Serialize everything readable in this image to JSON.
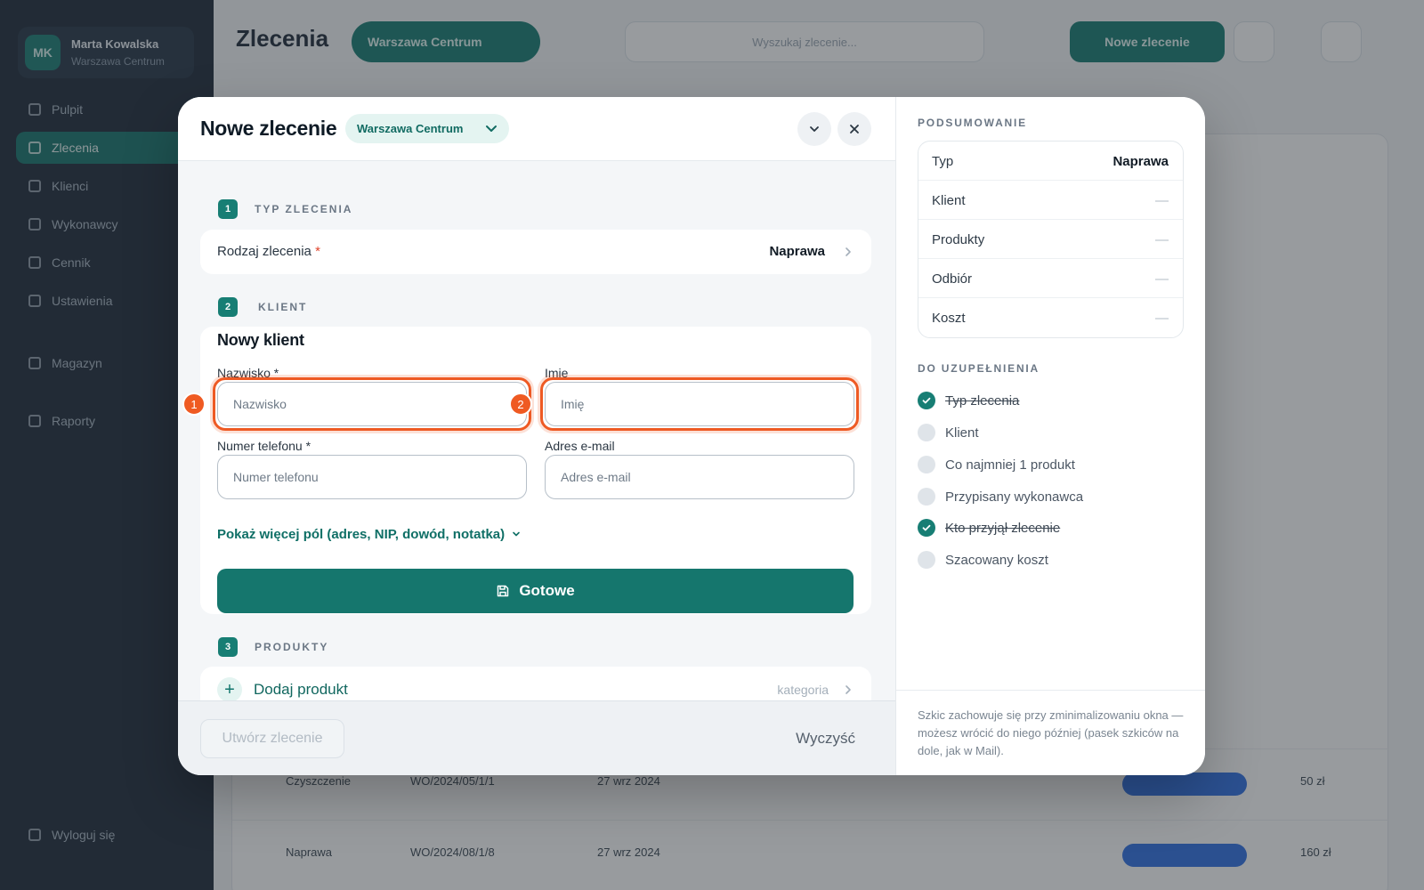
{
  "background": {
    "sidebar": {
      "user_initials": "MK",
      "user_name": "Marta Kowalska",
      "user_role": "Warszawa Centrum",
      "items": [
        {
          "label": "Pulpit"
        },
        {
          "label": "Zlecenia",
          "active": true
        },
        {
          "label": "Klienci"
        },
        {
          "label": "Wykonawcy"
        },
        {
          "label": "Cennik"
        },
        {
          "label": "Ustawienia"
        },
        {
          "label": "Magazyn"
        },
        {
          "label": "Raporty"
        },
        {
          "label": "Wyloguj się"
        }
      ]
    },
    "page_title": "Zlecenia",
    "location_pill": "Warszawa Centrum",
    "search_placeholder": "Wyszukaj zlecenie...",
    "new_order_button": "Nowe zlecenie",
    "rows": [
      {
        "type": "Czyszczenie",
        "number": "WO/2024/05/1/1",
        "date": "27 wrz 2024",
        "price": "50 zł"
      },
      {
        "type": "Naprawa",
        "number": "WO/2024/08/1/8",
        "date": "27 wrz 2024",
        "price": "160 zł"
      }
    ]
  },
  "modal": {
    "title": "Nowe zlecenie",
    "location": "Warszawa Centrum",
    "sections": {
      "type": {
        "number": "1",
        "label": "TYP ZLECENIA"
      },
      "client": {
        "number": "2",
        "label": "KLIENT"
      },
      "products": {
        "number": "3",
        "label": "PRODUKTY"
      }
    },
    "order_kind": {
      "label": "Rodzaj zlecenia",
      "required_mark": "*",
      "value": "Naprawa"
    },
    "client": {
      "title": "Nowy klient",
      "surname": {
        "label": "Nazwisko *",
        "placeholder": "Nazwisko",
        "value": "",
        "badge": "1"
      },
      "firstname": {
        "label": "Imię",
        "placeholder": "Imię",
        "value": "",
        "badge": "2"
      },
      "phone": {
        "label": "Numer telefonu *",
        "placeholder": "Numer telefonu",
        "value": ""
      },
      "email": {
        "label": "Adres e-mail",
        "placeholder": "Adres e-mail",
        "value": ""
      },
      "more_link": "Pokaż więcej pól (adres, NIP, dowód, notatka)",
      "done_button": "Gotowe"
    },
    "products": {
      "add_label": "Dodaj produkt",
      "category_hint": "kategoria"
    },
    "footer": {
      "create_button": "Utwórz zlecenie",
      "clear_button": "Wyczyść"
    },
    "summary": {
      "heading": "PODSUMOWANIE",
      "rows": [
        {
          "key": "Typ",
          "value": "Naprawa"
        },
        {
          "key": "Klient",
          "value": "—"
        },
        {
          "key": "Produkty",
          "value": "—"
        },
        {
          "key": "Odbiór",
          "value": "—"
        },
        {
          "key": "Koszt",
          "value": "—"
        }
      ]
    },
    "todo": {
      "heading": "DO UZUPEŁNIENIA",
      "items": [
        {
          "label": "Typ zlecenia",
          "done": true
        },
        {
          "label": "Klient",
          "done": false
        },
        {
          "label": "Co najmniej 1 produkt",
          "done": false
        },
        {
          "label": "Przypisany wykonawca",
          "done": false
        },
        {
          "label": "Kto przyjął zlecenie",
          "done": true
        },
        {
          "label": "Szacowany koszt",
          "done": false
        }
      ]
    },
    "draft_note": "Szkic zachowuje się przy zminimalizowaniu okna — możesz wrócić do niego później (pasek szkiców na dole, jak w Mail)."
  },
  "colors": {
    "accent": "#177e74",
    "highlight": "#ee5a24"
  }
}
